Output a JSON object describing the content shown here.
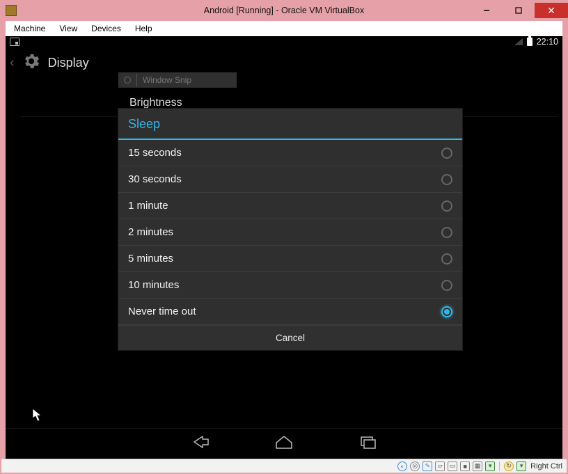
{
  "window": {
    "title": "Android [Running] - Oracle VM VirtualBox"
  },
  "menubar": {
    "items": [
      "Machine",
      "View",
      "Devices",
      "Help"
    ]
  },
  "android_status": {
    "time": "22:10"
  },
  "header": {
    "title": "Display"
  },
  "snippet_label": "Window Snip",
  "background_rows": {
    "brightness": "Brightness"
  },
  "dialog": {
    "title": "Sleep",
    "options": [
      {
        "label": "15 seconds",
        "selected": false
      },
      {
        "label": "30 seconds",
        "selected": false
      },
      {
        "label": "1 minute",
        "selected": false
      },
      {
        "label": "2 minutes",
        "selected": false
      },
      {
        "label": "5 minutes",
        "selected": false
      },
      {
        "label": "10 minutes",
        "selected": false
      },
      {
        "label": "Never time out",
        "selected": true
      }
    ],
    "cancel": "Cancel"
  },
  "host_status": {
    "host_key": "Right Ctrl"
  }
}
